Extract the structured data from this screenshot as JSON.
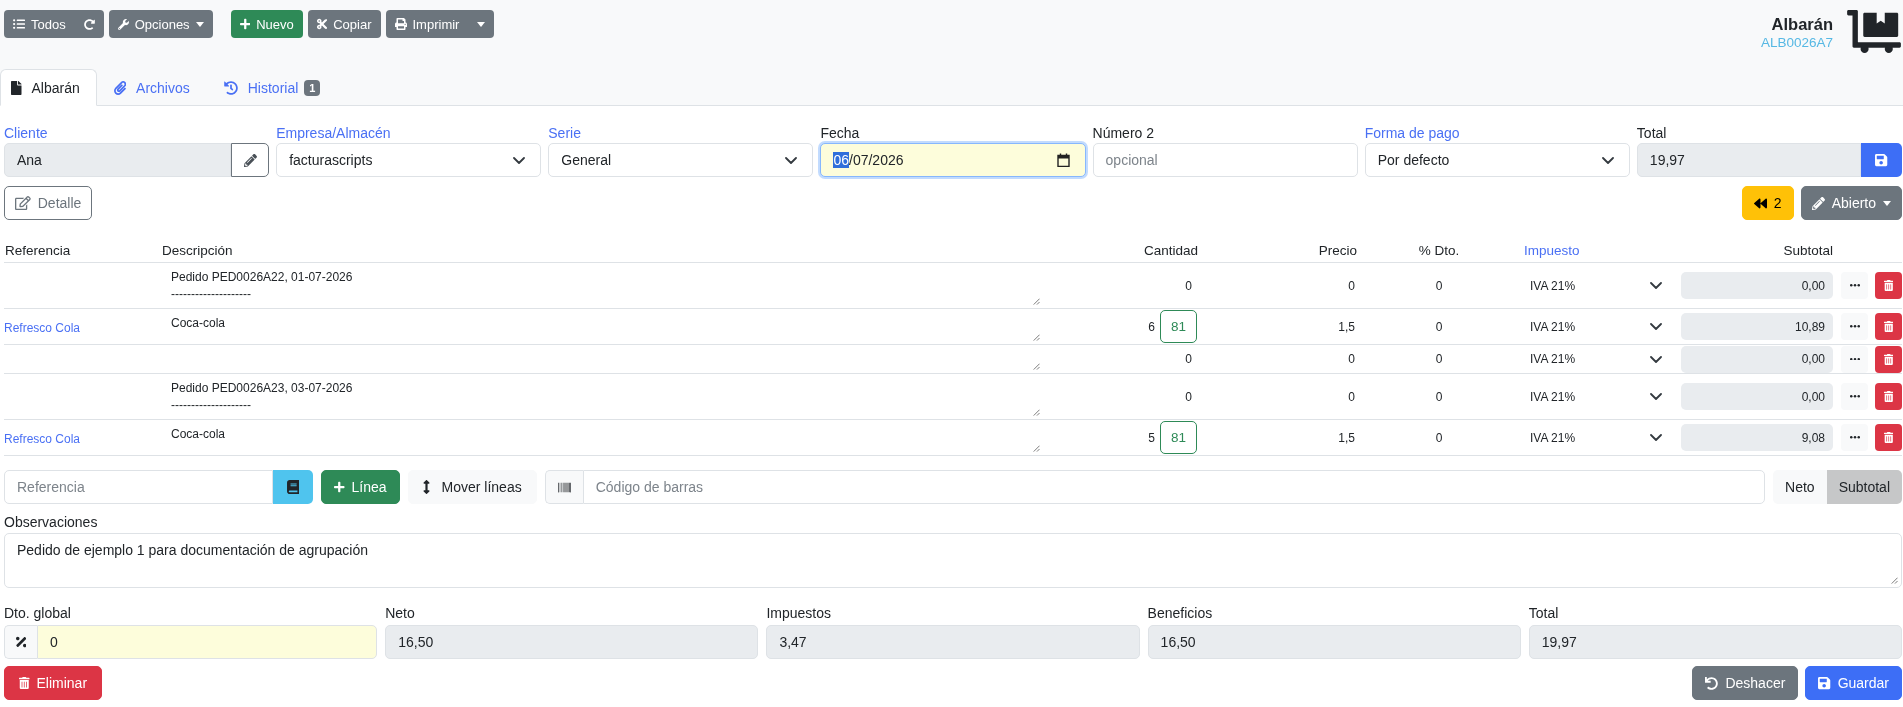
{
  "toolbar": [
    [
      {
        "kind": "list",
        "label": "Todos"
      },
      {
        "kind": "refresh"
      },
      {
        "kind": "options",
        "label": "Opciones"
      }
    ],
    [
      {
        "kind": "new",
        "label": "Nuevo"
      },
      {
        "kind": "copy",
        "label": "Copiar"
      },
      {
        "kind": "print",
        "label": "Imprimir"
      }
    ]
  ],
  "document": {
    "title": "Albarán",
    "code": "ALB0026A7"
  },
  "tabs": [
    {
      "label": "Albarán",
      "selected": true
    },
    {
      "label": "Archivos",
      "selected": false
    },
    {
      "label": "Historial",
      "selected": false,
      "badge": "1"
    }
  ],
  "fields": [
    {
      "label": "Cliente",
      "link": true,
      "kind": "picker",
      "value": "Ana",
      "highlight": false,
      "focused": false
    },
    {
      "label": "Empresa/Almacén",
      "link": true,
      "kind": "select",
      "value": "facturascripts",
      "highlight": false,
      "focused": false
    },
    {
      "label": "Serie",
      "link": true,
      "kind": "select",
      "value": "General",
      "highlight": false,
      "focused": false
    },
    {
      "label": "Fecha",
      "link": false,
      "kind": "date",
      "value": "06/07/2026",
      "highlight": true,
      "focused": true
    },
    {
      "label": "Número 2",
      "link": false,
      "kind": "text",
      "placeholder": "opcional",
      "highlight": false,
      "focused": false
    },
    {
      "label": "Forma de pago",
      "link": true,
      "kind": "select",
      "value": "Por defecto",
      "highlight": false,
      "focused": false
    },
    {
      "label": "Total",
      "link": false,
      "kind": "total",
      "value": "19,97",
      "highlight": false,
      "focused": false
    }
  ],
  "actions": {
    "detail": "Detalle",
    "grouped": "2",
    "status": "Abierto"
  },
  "table": {
    "columns": [
      {
        "label": "Referencia",
        "link": false
      },
      {
        "label": "Descripción",
        "link": false
      },
      {
        "label": "Cantidad",
        "link": false
      },
      {
        "label": "Precio",
        "link": false
      },
      {
        "label": "% Dto.",
        "link": false
      },
      {
        "label": "Impuesto",
        "link": true
      },
      {
        "label": "Subtotal",
        "link": false
      }
    ],
    "rows": [
      {
        "description": "Pedido PED0026A22, 01-07-2026\n--------------------",
        "quantity": "0",
        "price": "0",
        "discount": "0",
        "tax": "IVA 21%",
        "subtotal": "0,00"
      },
      {
        "reference": "Refresco Cola",
        "description": "Coca-cola",
        "quantity": "6",
        "stock": "81",
        "price": "1,5",
        "discount": "0",
        "tax": "IVA 21%",
        "subtotal": "10,89"
      },
      {
        "quantity": "0",
        "price": "0",
        "discount": "0",
        "tax": "IVA 21%",
        "subtotal": "0,00"
      },
      {
        "description": "Pedido PED0026A23, 03-07-2026\n--------------------",
        "quantity": "0",
        "price": "0",
        "discount": "0",
        "tax": "IVA 21%",
        "subtotal": "0,00"
      },
      {
        "reference": "Refresco Cola",
        "description": "Coca-cola",
        "quantity": "5",
        "stock": "81",
        "price": "1,5",
        "discount": "0",
        "tax": "IVA 21%",
        "subtotal": "9,08"
      }
    ]
  },
  "line_bar": {
    "reference": {
      "placeholder": "Referencia"
    },
    "add_label": "Línea",
    "move_label": "Mover líneas",
    "barcode": {
      "placeholder": "Código de barras"
    },
    "view_toggle": [
      {
        "label": "Neto",
        "selected": false
      },
      {
        "label": "Subtotal",
        "selected": true
      }
    ]
  },
  "notes": {
    "label": "Observaciones",
    "value": "Pedido de ejemplo 1 para documentación de agrupación"
  },
  "totals": [
    {
      "label": "Dto. global",
      "kind": "discount",
      "value": "0",
      "highlight": true
    },
    {
      "label": "Neto",
      "kind": "readonly",
      "value": "16,50",
      "highlight": false
    },
    {
      "label": "Impuestos",
      "kind": "readonly",
      "value": "3,47",
      "highlight": false
    },
    {
      "label": "Beneficios",
      "kind": "readonly",
      "value": "16,50",
      "highlight": false
    },
    {
      "label": "Total",
      "kind": "readonly",
      "value": "19,97",
      "highlight": false
    }
  ],
  "footer": {
    "delete": "Eliminar",
    "undo": "Deshacer",
    "save": "Guardar"
  }
}
